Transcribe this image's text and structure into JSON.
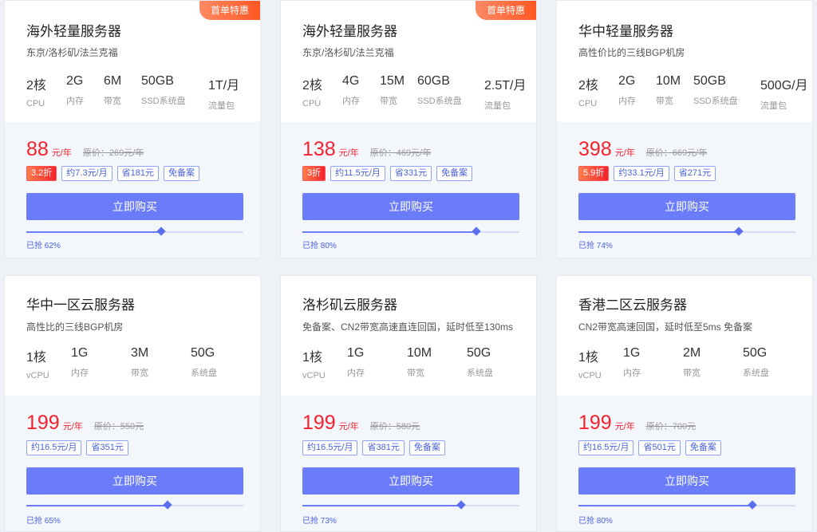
{
  "colors": {
    "accent": "#6b7cfb",
    "price": "#f5222d",
    "badge": "#ff5722"
  },
  "cards": [
    {
      "badge": "首单特惠",
      "title": "海外轻量服务器",
      "subtitle": "东京/洛杉矶/法兰克福",
      "specs": [
        {
          "value": "2核",
          "label": "CPU"
        },
        {
          "value": "2G",
          "label": "内存"
        },
        {
          "value": "6M",
          "label": "带宽"
        },
        {
          "value": "50GB",
          "label": "SSD系统盘"
        },
        {
          "value": "1T/月",
          "label": "流量包"
        }
      ],
      "price": "88",
      "unit": "元/年",
      "original": "原价：269元/年",
      "tags": [
        "3.2折",
        "约7.3元/月",
        "省181元",
        "免备案"
      ],
      "discount_tag": true,
      "buy_label": "立即购买",
      "progress": 0.62,
      "sold_text": "已抢 62%"
    },
    {
      "badge": "首单特惠",
      "title": "海外轻量服务器",
      "subtitle": "东京/洛杉矶/法兰克福",
      "specs": [
        {
          "value": "2核",
          "label": "CPU"
        },
        {
          "value": "4G",
          "label": "内存"
        },
        {
          "value": "15M",
          "label": "带宽"
        },
        {
          "value": "60GB",
          "label": "SSD系统盘"
        },
        {
          "value": "2.5T/月",
          "label": "流量包"
        }
      ],
      "price": "138",
      "unit": "元/年",
      "original": "原价：469元/年",
      "tags": [
        "3折",
        "约11.5元/月",
        "省331元",
        "免备案"
      ],
      "discount_tag": true,
      "buy_label": "立即购买",
      "progress": 0.8,
      "sold_text": "已抢 80%"
    },
    {
      "badge": "",
      "title": "华中轻量服务器",
      "subtitle": "高性价比的三线BGP机房",
      "specs": [
        {
          "value": "2核",
          "label": "CPU"
        },
        {
          "value": "2G",
          "label": "内存"
        },
        {
          "value": "10M",
          "label": "带宽"
        },
        {
          "value": "50GB",
          "label": "SSD系统盘"
        },
        {
          "value": "500G/月",
          "label": "流量包"
        }
      ],
      "price": "398",
      "unit": "元/年",
      "original": "原价：669元/年",
      "tags": [
        "5.9折",
        "约33.1元/月",
        "省271元"
      ],
      "discount_tag": true,
      "buy_label": "立即购买",
      "progress": 0.74,
      "sold_text": "已抢 74%"
    },
    {
      "badge": "",
      "title": "华中一区云服务器",
      "subtitle": "高性比的三线BGP机房",
      "specs": [
        {
          "value": "1核",
          "label": "vCPU"
        },
        {
          "value": "1G",
          "label": "内存"
        },
        {
          "value": "3M",
          "label": "带宽"
        },
        {
          "value": "50G",
          "label": "系统盘"
        }
      ],
      "price": "199",
      "unit": "元/年",
      "original": "原价：550元",
      "tags": [
        "约16.5元/月",
        "省351元"
      ],
      "discount_tag": false,
      "buy_label": "立即购买",
      "progress": 0.65,
      "sold_text": "已抢 65%"
    },
    {
      "badge": "",
      "title": "洛杉矶云服务器",
      "subtitle": "免备案、CN2带宽高速直连回国，延时低至130ms",
      "specs": [
        {
          "value": "1核",
          "label": "vCPU"
        },
        {
          "value": "1G",
          "label": "内存"
        },
        {
          "value": "10M",
          "label": "带宽"
        },
        {
          "value": "50G",
          "label": "系统盘"
        }
      ],
      "price": "199",
      "unit": "元/年",
      "original": "原价：580元",
      "tags": [
        "约16.5元/月",
        "省381元",
        "免备案"
      ],
      "discount_tag": false,
      "buy_label": "立即购买",
      "progress": 0.73,
      "sold_text": "已抢 73%"
    },
    {
      "badge": "",
      "title": "香港二区云服务器",
      "subtitle": "CN2带宽高速回国，延时低至5ms 免备案",
      "specs": [
        {
          "value": "1核",
          "label": "vCPU"
        },
        {
          "value": "1G",
          "label": "内存"
        },
        {
          "value": "2M",
          "label": "带宽"
        },
        {
          "value": "50G",
          "label": "系统盘"
        }
      ],
      "price": "199",
      "unit": "元/年",
      "original": "原价：700元",
      "tags": [
        "约16.5元/月",
        "省501元",
        "免备案"
      ],
      "discount_tag": false,
      "buy_label": "立即购买",
      "progress": 0.8,
      "sold_text": "已抢 80%"
    }
  ]
}
